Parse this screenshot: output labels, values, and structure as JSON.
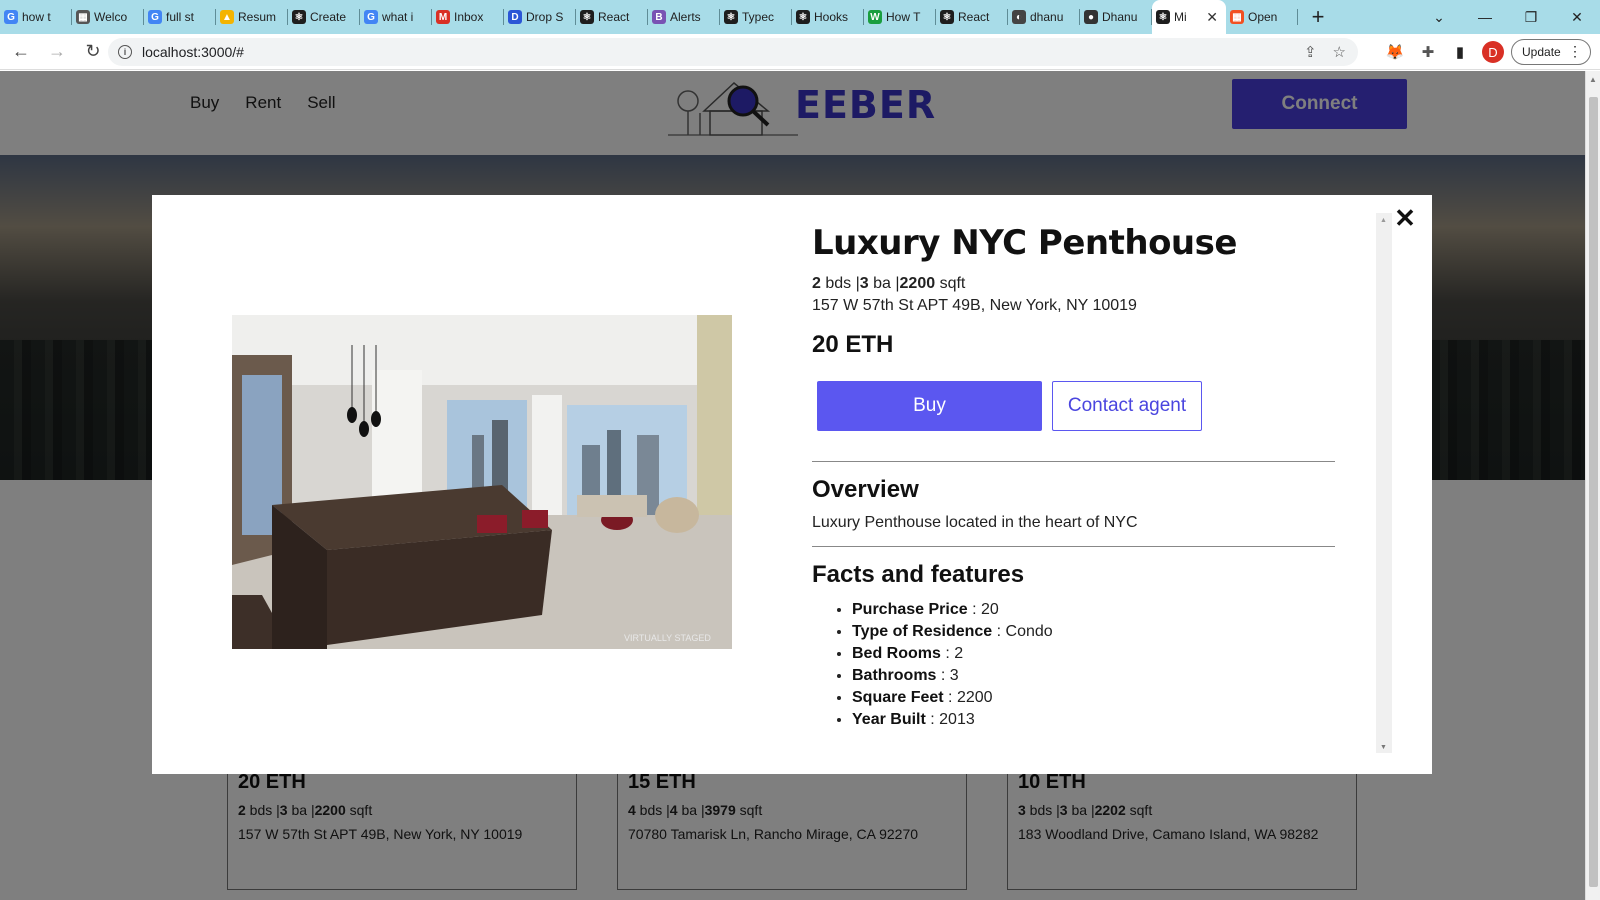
{
  "browser": {
    "tabs": [
      {
        "label": "how t",
        "fav": "G",
        "color": "#4285f4"
      },
      {
        "label": "Welco",
        "fav": "▦",
        "color": "#555555"
      },
      {
        "label": "full st",
        "fav": "G",
        "color": "#4285f4"
      },
      {
        "label": "Resum",
        "fav": "▲",
        "color": "#f4b400"
      },
      {
        "label": "Create",
        "fav": "⚛",
        "color": "#1e1e1e"
      },
      {
        "label": "what i",
        "fav": "G",
        "color": "#4285f4"
      },
      {
        "label": "Inbox",
        "fav": "M",
        "color": "#d93025"
      },
      {
        "label": "Drop S",
        "fav": "D",
        "color": "#2b56d6"
      },
      {
        "label": "React",
        "fav": "⚛",
        "color": "#1e1e1e"
      },
      {
        "label": "Alerts",
        "fav": "B",
        "color": "#7952b3"
      },
      {
        "label": "Typec",
        "fav": "⚛",
        "color": "#1e1e1e"
      },
      {
        "label": "Hooks",
        "fav": "⚛",
        "color": "#1e1e1e"
      },
      {
        "label": "How T",
        "fav": "W",
        "color": "#1a9e3f"
      },
      {
        "label": "React",
        "fav": "⚛",
        "color": "#1e1e1e"
      },
      {
        "label": "dhanu",
        "fav": "◐",
        "color": "#444444"
      },
      {
        "label": "Dhanu",
        "fav": "●",
        "color": "#333333"
      },
      {
        "label": "Mi",
        "fav": "⚛",
        "color": "#1e1e1e",
        "active": true
      },
      {
        "label": "Open",
        "fav": "▦",
        "color": "#f25022"
      }
    ],
    "url": "localhost:3000/#",
    "update_label": "Update",
    "profile_initial": "D"
  },
  "site": {
    "nav": [
      "Buy",
      "Rent",
      "Sell"
    ],
    "logo_text": "EEBER",
    "connect_label": "Connect"
  },
  "cards": [
    {
      "price": "20 ETH",
      "beds": "2",
      "baths": "3",
      "sqft": "2200",
      "address": "157 W 57th St APT 49B, New York, NY 10019"
    },
    {
      "price": "15 ETH",
      "beds": "4",
      "baths": "4",
      "sqft": "3979",
      "address": "70780 Tamarisk Ln, Rancho Mirage, CA 92270"
    },
    {
      "price": "10 ETH",
      "beds": "3",
      "baths": "3",
      "sqft": "2202",
      "address": "183 Woodland Drive, Camano Island, WA 98282"
    }
  ],
  "modal": {
    "title": "Luxury NYC Penthouse",
    "beds": "2",
    "baths": "3",
    "sqft": "2200",
    "bds_label": "bds",
    "ba_label": "ba",
    "sqft_label": "sqft",
    "address": "157 W 57th St APT 49B, New York, NY 10019",
    "price": "20 ETH",
    "buy_label": "Buy",
    "contact_label": "Contact agent",
    "overview_heading": "Overview",
    "overview_text": "Luxury Penthouse located in the heart of NYC",
    "facts_heading": "Facts and features",
    "image_watermark": "VIRTUALLY STAGED",
    "close_glyph": "✕",
    "facts": [
      {
        "label": "Purchase Price",
        "value": "20"
      },
      {
        "label": "Type of Residence",
        "value": "Condo"
      },
      {
        "label": "Bed Rooms",
        "value": "2"
      },
      {
        "label": "Bathrooms",
        "value": "3"
      },
      {
        "label": "Square Feet",
        "value": "2200"
      },
      {
        "label": "Year Built",
        "value": "2013"
      }
    ]
  }
}
